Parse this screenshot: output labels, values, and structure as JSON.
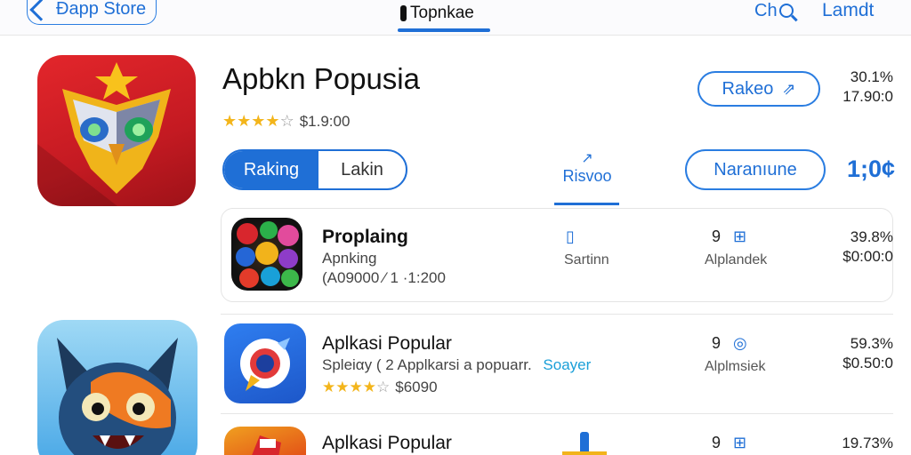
{
  "topbar": {
    "back_label": "Đapp Store",
    "center_title": "Topnkae",
    "right_1": "Ch",
    "right_2": "Lamdt"
  },
  "hero": {
    "title": "Apbkn Popusia",
    "stars": [
      "★",
      "★",
      "★",
      "★",
      "☆"
    ],
    "rating_text": "$1.9:00",
    "segment": {
      "active": "Raking",
      "inactive": "Lakin"
    },
    "tab_label": "Risvoo",
    "tab_icon": "↗",
    "pill_top": "Rakeo",
    "pill_top_icon": "⇗",
    "pill_mid": "Naranıune",
    "number_blue": "1;0¢",
    "price_top_1": "30.1%",
    "price_top_2": "17.90:0"
  },
  "rows": [
    {
      "title": "Proplaing",
      "sub": "Apnking",
      "meta": "(A09000 ⁄ 1 ·1:200",
      "col_icon": "▯",
      "col_label": "Sartinn",
      "num": "9",
      "num_icon": "⊞",
      "num_label": "Alplandek",
      "price_1": "39.8%",
      "price_2": "$0:00:0"
    },
    {
      "title": "Aplkasi Popular",
      "sub": "Spleiαy ( 2 Applkarsi a popuarr.",
      "sub_blue": "Soayer",
      "stars": [
        "★",
        "★",
        "★",
        "★",
        "☆"
      ],
      "rating_text": "$6090",
      "num": "9",
      "num_icon": "◎",
      "num_label": "Alplmsiek",
      "price_1": "59.3%",
      "price_2": "$0.50:0"
    },
    {
      "title": "Aplkasi Popular",
      "num": "9",
      "num_icon": "⊞",
      "price_1": "19.73%"
    }
  ],
  "colors": {
    "accent": "#1f6fd6",
    "star": "#f3b51b",
    "hero_icon_red": "#d4202a"
  },
  "icons": {
    "back": "chevron-left-icon",
    "search": "search-icon"
  }
}
